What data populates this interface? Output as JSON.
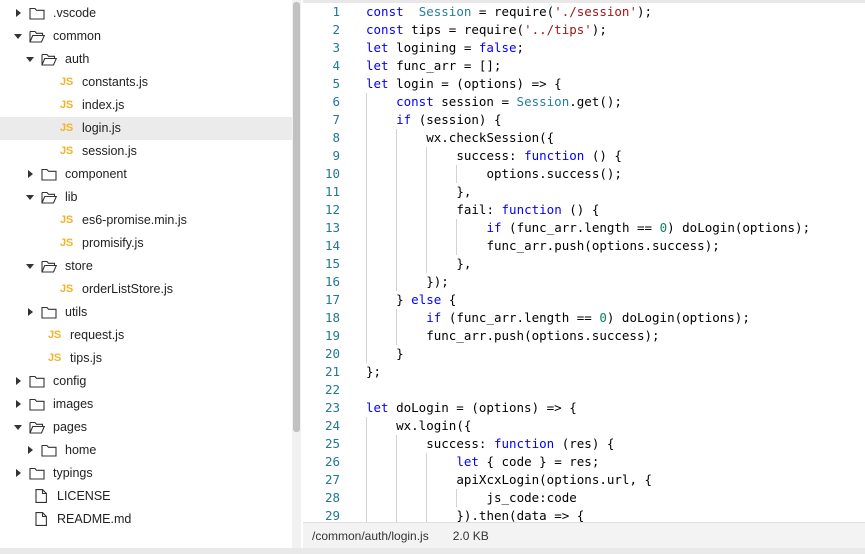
{
  "file_tree": [
    {
      "label": ".vscode",
      "type": "folder",
      "open": false,
      "depth": 0
    },
    {
      "label": "common",
      "type": "folder",
      "open": true,
      "depth": 0
    },
    {
      "label": "auth",
      "type": "folder",
      "open": true,
      "depth": 1
    },
    {
      "label": "constants.js",
      "type": "js",
      "depth": 2
    },
    {
      "label": "index.js",
      "type": "js",
      "depth": 2
    },
    {
      "label": "login.js",
      "type": "js",
      "depth": 2,
      "selected": true
    },
    {
      "label": "session.js",
      "type": "js",
      "depth": 2
    },
    {
      "label": "component",
      "type": "folder",
      "open": false,
      "depth": 1
    },
    {
      "label": "lib",
      "type": "folder",
      "open": true,
      "depth": 1
    },
    {
      "label": "es6-promise.min.js",
      "type": "js",
      "depth": 2
    },
    {
      "label": "promisify.js",
      "type": "js",
      "depth": 2
    },
    {
      "label": "store",
      "type": "folder",
      "open": true,
      "depth": 1
    },
    {
      "label": "orderListStore.js",
      "type": "js",
      "depth": 2
    },
    {
      "label": "utils",
      "type": "folder",
      "open": false,
      "depth": 1
    },
    {
      "label": "request.js",
      "type": "js",
      "depth": 1
    },
    {
      "label": "tips.js",
      "type": "js",
      "depth": 1
    },
    {
      "label": "config",
      "type": "folder",
      "open": false,
      "depth": 0
    },
    {
      "label": "images",
      "type": "folder",
      "open": false,
      "depth": 0
    },
    {
      "label": "pages",
      "type": "folder",
      "open": true,
      "depth": 0
    },
    {
      "label": "home",
      "type": "folder",
      "open": false,
      "depth": 1
    },
    {
      "label": "typings",
      "type": "folder",
      "open": false,
      "depth": 0
    },
    {
      "label": "LICENSE",
      "type": "file",
      "depth": 0
    },
    {
      "label": "README.md",
      "type": "file",
      "depth": 0
    }
  ],
  "js_badge": "JS",
  "editor": {
    "lines": [
      {
        "n": "1",
        "indent": 0,
        "tokens": [
          [
            "kw",
            "const"
          ],
          [
            "",
            "  "
          ],
          [
            "cls",
            "Session"
          ],
          [
            "",
            " = require("
          ],
          [
            "str",
            "'./session'"
          ],
          [
            "",
            ");"
          ]
        ]
      },
      {
        "n": "2",
        "indent": 0,
        "tokens": [
          [
            "kw",
            "const"
          ],
          [
            "",
            " tips = require("
          ],
          [
            "str",
            "'../tips'"
          ],
          [
            "",
            ");"
          ]
        ]
      },
      {
        "n": "3",
        "indent": 0,
        "tokens": [
          [
            "kw",
            "let"
          ],
          [
            "",
            " logining = "
          ],
          [
            "kw",
            "false"
          ],
          [
            "",
            ";"
          ]
        ]
      },
      {
        "n": "4",
        "indent": 0,
        "tokens": [
          [
            "kw",
            "let"
          ],
          [
            "",
            " func_arr = [];"
          ]
        ]
      },
      {
        "n": "5",
        "indent": 0,
        "tokens": [
          [
            "kw",
            "let"
          ],
          [
            "",
            " login = (options) => {"
          ]
        ]
      },
      {
        "n": "6",
        "indent": 1,
        "tokens": [
          [
            "kw",
            "const"
          ],
          [
            "",
            " session = "
          ],
          [
            "cls",
            "Session"
          ],
          [
            "",
            ".get();"
          ]
        ]
      },
      {
        "n": "7",
        "indent": 1,
        "tokens": [
          [
            "kw",
            "if"
          ],
          [
            "",
            " (session) {"
          ]
        ]
      },
      {
        "n": "8",
        "indent": 2,
        "tokens": [
          [
            "",
            "wx.checkSession({"
          ]
        ]
      },
      {
        "n": "9",
        "indent": 3,
        "tokens": [
          [
            "",
            "success: "
          ],
          [
            "kw",
            "function"
          ],
          [
            "",
            " () {"
          ]
        ]
      },
      {
        "n": "10",
        "indent": 4,
        "tokens": [
          [
            "",
            "options.success();"
          ]
        ]
      },
      {
        "n": "11",
        "indent": 3,
        "tokens": [
          [
            "",
            "},"
          ]
        ]
      },
      {
        "n": "12",
        "indent": 3,
        "tokens": [
          [
            "",
            "fail: "
          ],
          [
            "kw",
            "function"
          ],
          [
            "",
            " () {"
          ]
        ]
      },
      {
        "n": "13",
        "indent": 4,
        "tokens": [
          [
            "kw",
            "if"
          ],
          [
            "",
            " (func_arr.length == "
          ],
          [
            "num",
            "0"
          ],
          [
            "",
            ") doLogin(options);"
          ]
        ]
      },
      {
        "n": "14",
        "indent": 4,
        "tokens": [
          [
            "",
            "func_arr.push(options.success);"
          ]
        ]
      },
      {
        "n": "15",
        "indent": 3,
        "tokens": [
          [
            "",
            "},"
          ]
        ]
      },
      {
        "n": "16",
        "indent": 2,
        "tokens": [
          [
            "",
            "});"
          ]
        ]
      },
      {
        "n": "17",
        "indent": 1,
        "tokens": [
          [
            "",
            "} "
          ],
          [
            "kw",
            "else"
          ],
          [
            "",
            " {"
          ]
        ]
      },
      {
        "n": "18",
        "indent": 2,
        "tokens": [
          [
            "kw",
            "if"
          ],
          [
            "",
            " (func_arr.length == "
          ],
          [
            "num",
            "0"
          ],
          [
            "",
            ") doLogin(options);"
          ]
        ]
      },
      {
        "n": "19",
        "indent": 2,
        "tokens": [
          [
            "",
            "func_arr.push(options.success);"
          ]
        ]
      },
      {
        "n": "20",
        "indent": 1,
        "tokens": [
          [
            "",
            "}"
          ]
        ]
      },
      {
        "n": "21",
        "indent": 0,
        "tokens": [
          [
            "",
            "};"
          ]
        ]
      },
      {
        "n": "22",
        "indent": 0,
        "tokens": []
      },
      {
        "n": "23",
        "indent": 0,
        "tokens": [
          [
            "kw",
            "let"
          ],
          [
            "",
            " doLogin = (options) => {"
          ]
        ]
      },
      {
        "n": "24",
        "indent": 1,
        "tokens": [
          [
            "",
            "wx.login({"
          ]
        ]
      },
      {
        "n": "25",
        "indent": 2,
        "tokens": [
          [
            "",
            "success: "
          ],
          [
            "kw",
            "function"
          ],
          [
            "",
            " (res) {"
          ]
        ]
      },
      {
        "n": "26",
        "indent": 3,
        "tokens": [
          [
            "kw",
            "let"
          ],
          [
            "",
            " { code } = res;"
          ]
        ]
      },
      {
        "n": "27",
        "indent": 3,
        "tokens": [
          [
            "",
            "apiXcxLogin(options.url, {"
          ]
        ]
      },
      {
        "n": "28",
        "indent": 4,
        "tokens": [
          [
            "",
            "js_code:code"
          ]
        ]
      },
      {
        "n": "29",
        "indent": 3,
        "tokens": [
          [
            "",
            "}).then(data => {"
          ]
        ]
      }
    ]
  },
  "status": {
    "path": "/common/auth/login.js",
    "size": "2.0 KB"
  }
}
